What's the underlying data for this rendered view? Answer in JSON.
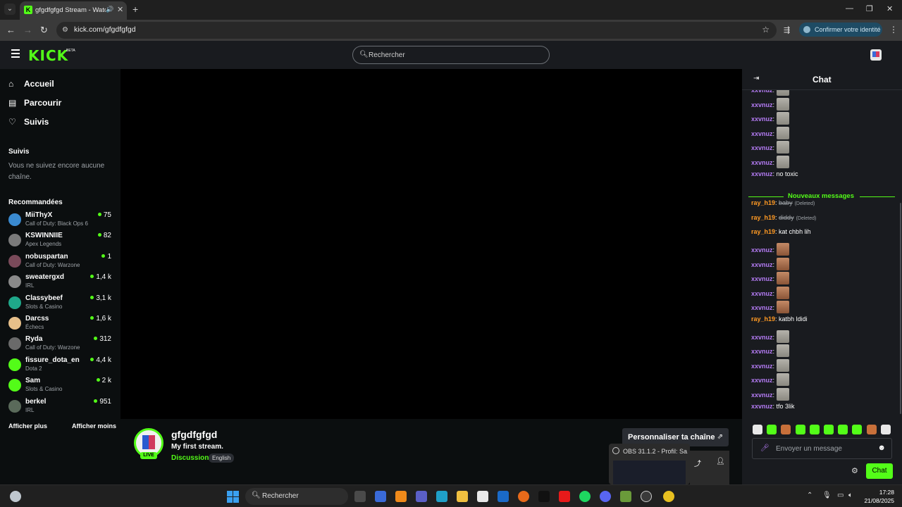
{
  "browser": {
    "tab_title": "gfgdfgfgd Stream - Watch l",
    "url": "kick.com/gfgdfgfgd",
    "identity_button": "Confirmer votre identité"
  },
  "header": {
    "logo": "KICK",
    "beta": "BETA",
    "search_placeholder": "Rechercher"
  },
  "sidebar": {
    "nav": [
      {
        "label": "Accueil",
        "icon": "home-icon"
      },
      {
        "label": "Parcourir",
        "icon": "browse-icon"
      },
      {
        "label": "Suivis",
        "icon": "heart-icon"
      }
    ],
    "following_heading": "Suivis",
    "following_empty": "Vous ne suivez encore aucune chaîne.",
    "recommended_heading": "Recommandées",
    "recommended": [
      {
        "name": "MiiThyX",
        "game": "Call of Duty: Black Ops 6",
        "viewers": "75",
        "color": "#3a8ad0"
      },
      {
        "name": "KSWINNIIE",
        "game": "Apex Legends",
        "viewers": "82",
        "color": "#7a7a7a"
      },
      {
        "name": "nobuspartan",
        "game": "Call of Duty: Warzone",
        "viewers": "1",
        "color": "#7a4a5a"
      },
      {
        "name": "sweatergxd",
        "game": "IRL",
        "viewers": "1,4 k",
        "color": "#8a8a8a"
      },
      {
        "name": "Classybeef",
        "game": "Slots & Casino",
        "viewers": "3,1 k",
        "color": "#1fa88a"
      },
      {
        "name": "Darcss",
        "game": "Échecs",
        "viewers": "1,6 k",
        "color": "#e8c08a"
      },
      {
        "name": "Ryda",
        "game": "Call of Duty: Warzone",
        "viewers": "312",
        "color": "#6a6a6a"
      },
      {
        "name": "fissure_dota_en",
        "game": "Dota 2",
        "viewers": "4,4 k",
        "color": "#53fc18"
      },
      {
        "name": "Sam",
        "game": "Slots & Casino",
        "viewers": "2 k",
        "color": "#53fc18"
      },
      {
        "name": "berkel",
        "game": "IRL",
        "viewers": "951",
        "color": "#5a6a5a"
      }
    ],
    "show_more": "Afficher plus",
    "show_less": "Afficher moins"
  },
  "stream": {
    "channel": "gfgdfgfgd",
    "title": "My first stream.",
    "category": "Discussion",
    "language": "English",
    "live": "LIVE",
    "customize": "Personnaliser ta chaîne"
  },
  "obs_popup": {
    "label": "OBS 31.1.2 - Profil: Sa..."
  },
  "chat": {
    "title": "Chat",
    "new_messages": "Nouveaux messages",
    "messages": [
      {
        "user": "xxvnuz",
        "color": "purple",
        "emote": "cat"
      },
      {
        "user": "xxvnuz",
        "color": "purple",
        "emote": "cat"
      },
      {
        "user": "xxvnuz",
        "color": "purple",
        "emote": "cat"
      },
      {
        "user": "xxvnuz",
        "color": "purple",
        "emote": "cat"
      },
      {
        "user": "xxvnuz",
        "color": "purple",
        "emote": "cat"
      },
      {
        "user": "xxvnuz",
        "color": "purple",
        "emote": "cat"
      },
      {
        "user": "xxvnuz",
        "color": "purple",
        "text": "no toxic"
      },
      {
        "user": "ray_h19",
        "color": "orange",
        "deleted": "baby",
        "tag": "(Deleted)"
      },
      {
        "user": "ray_h19",
        "color": "orange",
        "deleted": "diddy",
        "tag": "(Deleted)"
      },
      {
        "user": "ray_h19",
        "color": "orange",
        "text": "kat chbh lih"
      },
      {
        "user": "xxvnuz",
        "color": "purple",
        "emote": "face"
      },
      {
        "user": "xxvnuz",
        "color": "purple",
        "emote": "face"
      },
      {
        "user": "xxvnuz",
        "color": "purple",
        "emote": "face"
      },
      {
        "user": "xxvnuz",
        "color": "purple",
        "emote": "face"
      },
      {
        "user": "xxvnuz",
        "color": "purple",
        "emote": "face"
      },
      {
        "user": "ray_h19",
        "color": "orange",
        "text": "katbh ldidi"
      },
      {
        "user": "xxvnuz",
        "color": "purple",
        "emote": "cat"
      },
      {
        "user": "xxvnuz",
        "color": "purple",
        "emote": "cat"
      },
      {
        "user": "xxvnuz",
        "color": "purple",
        "emote": "cat"
      },
      {
        "user": "xxvnuz",
        "color": "purple",
        "emote": "cat"
      },
      {
        "user": "xxvnuz",
        "color": "purple",
        "emote": "cat"
      },
      {
        "user": "xxvnuz",
        "color": "purple",
        "text": "tfo 3lik"
      }
    ],
    "input_placeholder": "Envoyer un message",
    "send_label": "Chat"
  },
  "taskbar": {
    "search": "Rechercher",
    "time": "17:28",
    "date": "21/08/2025"
  }
}
